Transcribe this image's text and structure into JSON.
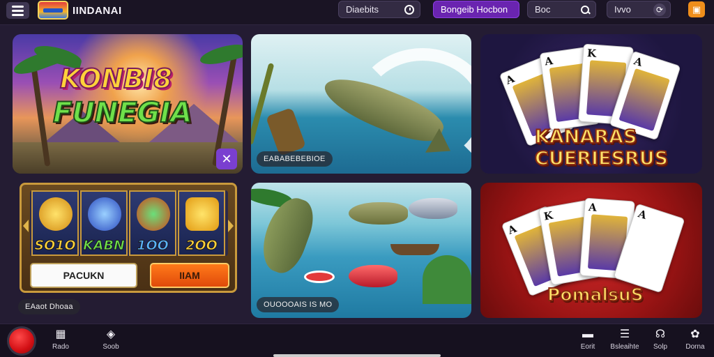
{
  "header": {
    "brand_name": "IINDANAI",
    "pill_1": "Diaebits",
    "pill_2": "Bongeib Hocbon",
    "search_label": "Boc",
    "pill_4": "Ivvo",
    "orange_icon": "gift-icon"
  },
  "cards": {
    "jungle": {
      "title_line1": "KONBI8",
      "title_line2": "FUNEGIA"
    },
    "fishing": {
      "label": "EABABEBEBIOE"
    },
    "cards_purple": {
      "title": "KANARAS CUERIESRUS"
    },
    "slot": {
      "values": [
        "SO1O",
        "KABN",
        "1OO",
        "2OO"
      ],
      "button_left": "PACUKN",
      "button_right": "IIAM",
      "caption": "EAaot Dhoaa"
    },
    "pond": {
      "label": "OUOOOAIS IS MO"
    },
    "cards_red": {
      "title": "PomalsuS"
    }
  },
  "bottom_nav": {
    "left_items": [
      {
        "label": "Rado",
        "icon": "grid-icon"
      },
      {
        "label": "Soob",
        "icon": "chat-icon"
      }
    ],
    "right_items": [
      {
        "label": "Eorit",
        "icon": "message-icon"
      },
      {
        "label": "Bsleaihte",
        "icon": "layers-icon"
      },
      {
        "label": "Solp",
        "icon": "support-icon"
      },
      {
        "label": "Dorna",
        "icon": "settings-icon"
      }
    ]
  }
}
